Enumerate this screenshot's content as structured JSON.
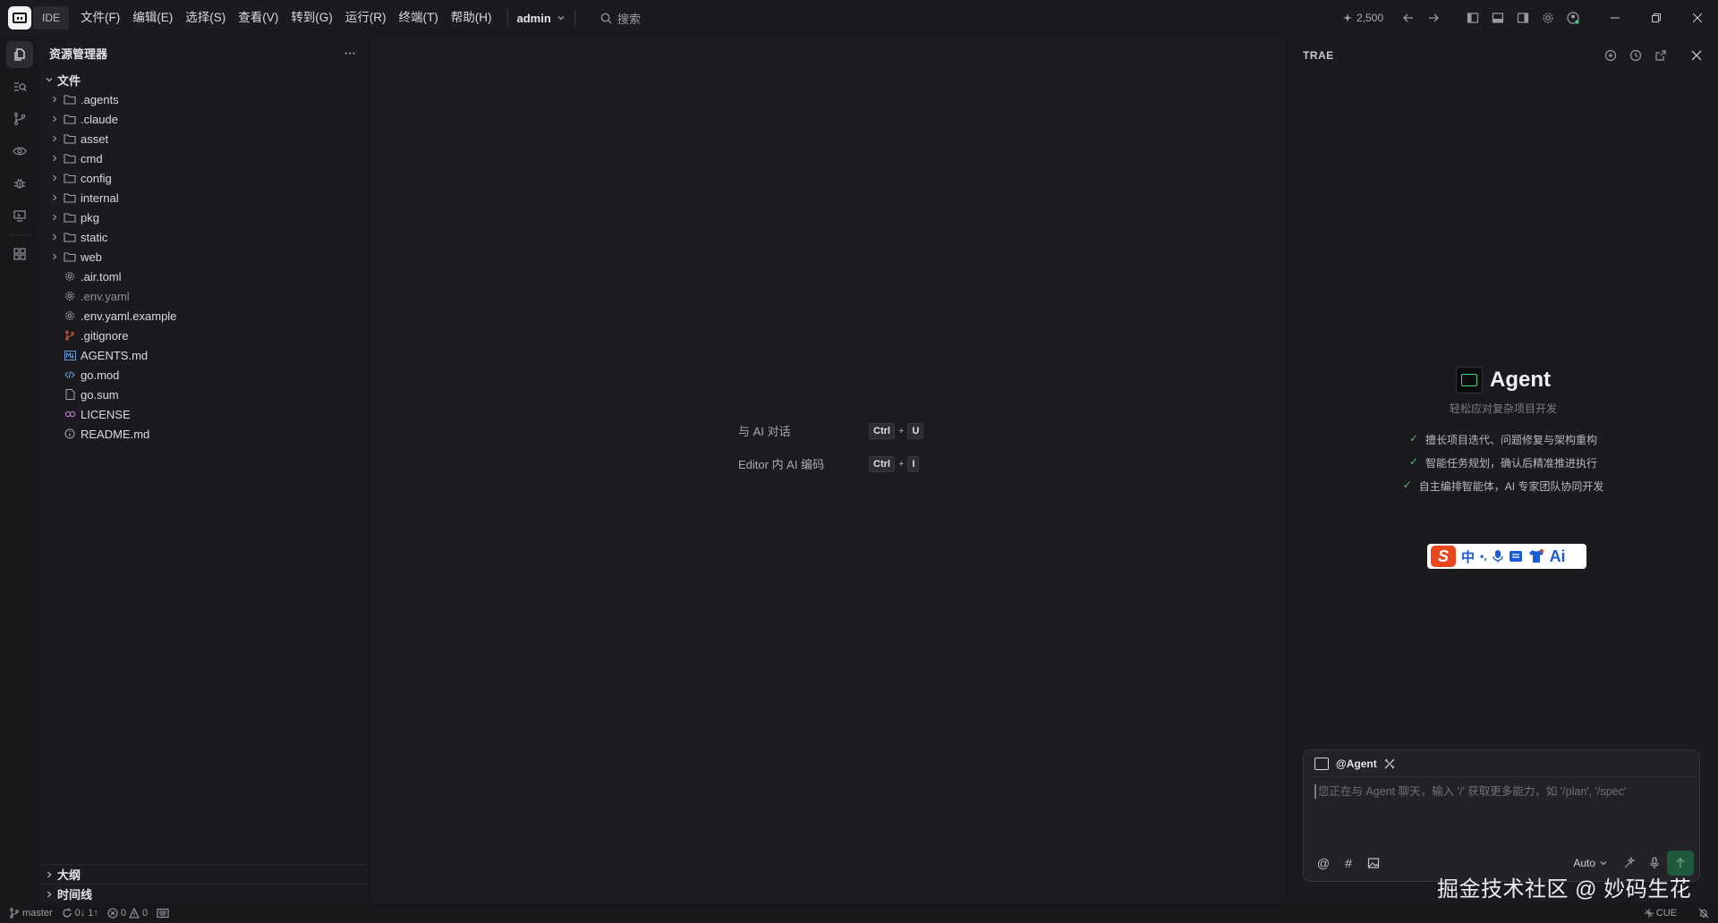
{
  "titlebar": {
    "ide_label": "IDE",
    "menus": [
      "文件(F)",
      "编辑(E)",
      "选择(S)",
      "查看(V)",
      "转到(G)",
      "运行(R)",
      "终端(T)",
      "帮助(H)"
    ],
    "user": "admin",
    "search_placeholder": "搜索",
    "credits": "2,500"
  },
  "explorer": {
    "title": "资源管理器",
    "more": "···",
    "root": "文件",
    "folders": [
      ".agents",
      ".claude",
      "asset",
      "cmd",
      "config",
      "internal",
      "pkg",
      "static",
      "web"
    ],
    "files": [
      {
        "name": ".air.toml",
        "icon": "gear-icon",
        "dim": false
      },
      {
        "name": ".env.yaml",
        "icon": "gear-icon",
        "dim": true
      },
      {
        "name": ".env.yaml.example",
        "icon": "gear-icon",
        "dim": false
      },
      {
        "name": ".gitignore",
        "icon": "git-icon",
        "dim": false
      },
      {
        "name": "AGENTS.md",
        "icon": "markdown-icon",
        "dim": false
      },
      {
        "name": "go.mod",
        "icon": "code-icon",
        "dim": false
      },
      {
        "name": "go.sum",
        "icon": "file-icon",
        "dim": false
      },
      {
        "name": "LICENSE",
        "icon": "license-icon",
        "dim": false
      },
      {
        "name": "README.md",
        "icon": "info-icon",
        "dim": false
      }
    ],
    "outline": "大纲",
    "timeline": "时间线"
  },
  "editor": {
    "hints": [
      {
        "label": "与 AI 对话",
        "mod": "Ctrl",
        "plus": "+",
        "key": "U"
      },
      {
        "label": "Editor 内 AI 编码",
        "mod": "Ctrl",
        "plus": "+",
        "key": "I"
      }
    ]
  },
  "ai_panel": {
    "title": "TRAE",
    "agent_name": "Agent",
    "agent_subtitle": "轻松应对复杂项目开发",
    "features": [
      "擅长项目迭代、问题修复与架构重构",
      "智能任务规划，确认后精准推进执行",
      "自主编排智能体，AI 专家团队协同开发"
    ],
    "ime_bar": {
      "logo": "S",
      "lang": "中",
      "punct": "•,",
      "ai": "Ai"
    },
    "chat": {
      "mention": "@Agent",
      "placeholder": "您正在与 Agent 聊天，输入 '/' 获取更多能力，如 '/plan', '/spec'",
      "at": "@",
      "hash": "#",
      "mode": "Auto"
    }
  },
  "status": {
    "branch": "master",
    "sync": "0↓ 1↑",
    "errors": "0",
    "warnings": "0",
    "right_label": "CUE"
  },
  "watermark": "掘金技术社区 @ 妙码生花",
  "colors": {
    "accent_green": "#1f5a3c",
    "check_green": "#4bc07a",
    "ime_orange": "#e8461e"
  }
}
